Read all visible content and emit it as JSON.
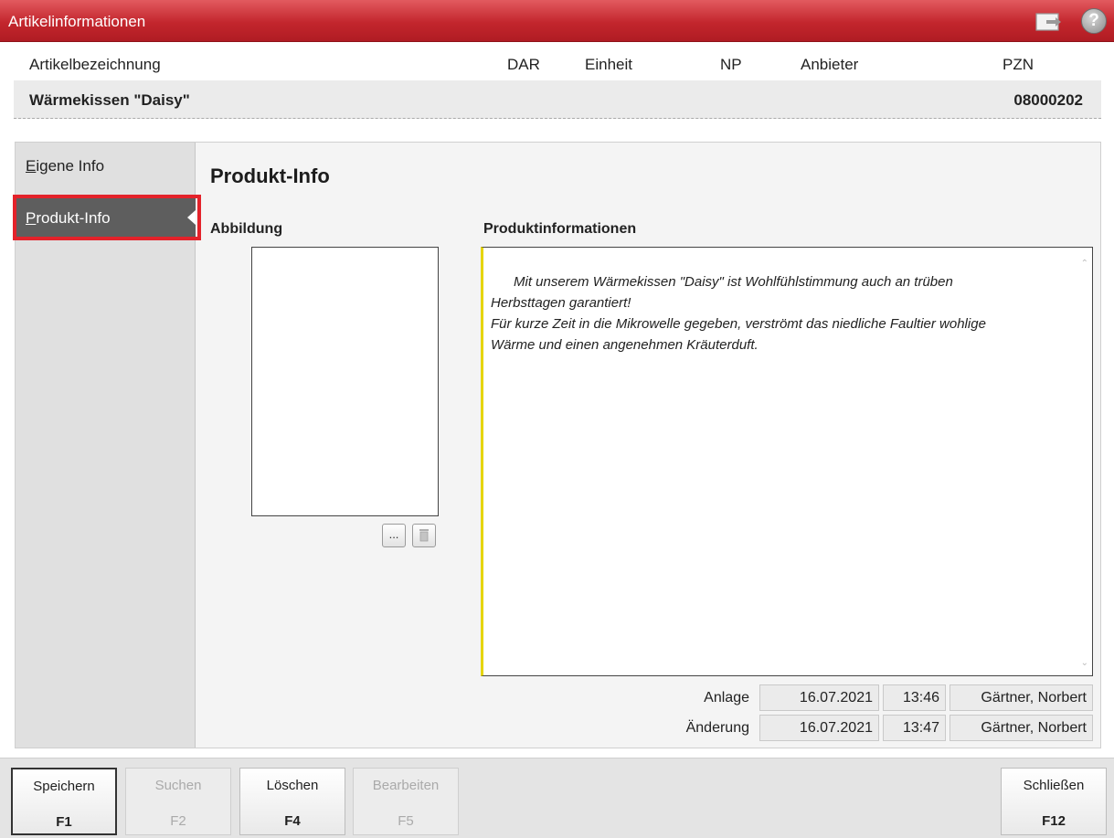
{
  "window": {
    "title": "Artikelinformationen"
  },
  "header": {
    "columns": [
      "Artikelbezeichnung",
      "DAR",
      "Einheit",
      "NP",
      "Anbieter",
      "PZN"
    ],
    "article_name": "Wärmekissen \"Daisy\"",
    "pzn": "08000202"
  },
  "sidebar": {
    "items": [
      {
        "label": "Eigene Info",
        "selected": false
      },
      {
        "label": "Produkt-Info",
        "selected": true
      }
    ]
  },
  "content": {
    "section_title": "Produkt-Info",
    "image_label": "Abbildung",
    "info_label": "Produktinformationen",
    "image_browse_label": "...",
    "info_text": "Mit unserem Wärmekissen \"Daisy\" ist Wohlfühlstimmung auch an trüben\nHerbsttagen garantiert!\nFür kurze Zeit in die Mikrowelle gegeben, verströmt das niedliche Faultier wohlige\nWärme und einen angenehmen Kräuterduft."
  },
  "meta": {
    "anlage": {
      "label": "Anlage",
      "date": "16.07.2021",
      "time": "13:46",
      "user": "Gärtner, Norbert"
    },
    "aenderung": {
      "label": "Änderung",
      "date": "16.07.2021",
      "time": "13:47",
      "user": "Gärtner, Norbert"
    }
  },
  "footer": {
    "buttons": [
      {
        "label": "Speichern",
        "key": "F1",
        "enabled": true
      },
      {
        "label": "Suchen",
        "key": "F2",
        "enabled": false
      },
      {
        "label": "Löschen",
        "key": "F4",
        "enabled": true
      },
      {
        "label": "Bearbeiten",
        "key": "F5",
        "enabled": false
      },
      {
        "label": "Schließen",
        "key": "F12",
        "enabled": true
      }
    ]
  },
  "colors": {
    "title_bar": "#c3262d",
    "highlight": "#e3222a",
    "nav_selected": "#5e5e5e",
    "text_marker": "#e6d500"
  },
  "icons": [
    "export-icon",
    "help-icon",
    "browse-icon",
    "trash-icon"
  ]
}
